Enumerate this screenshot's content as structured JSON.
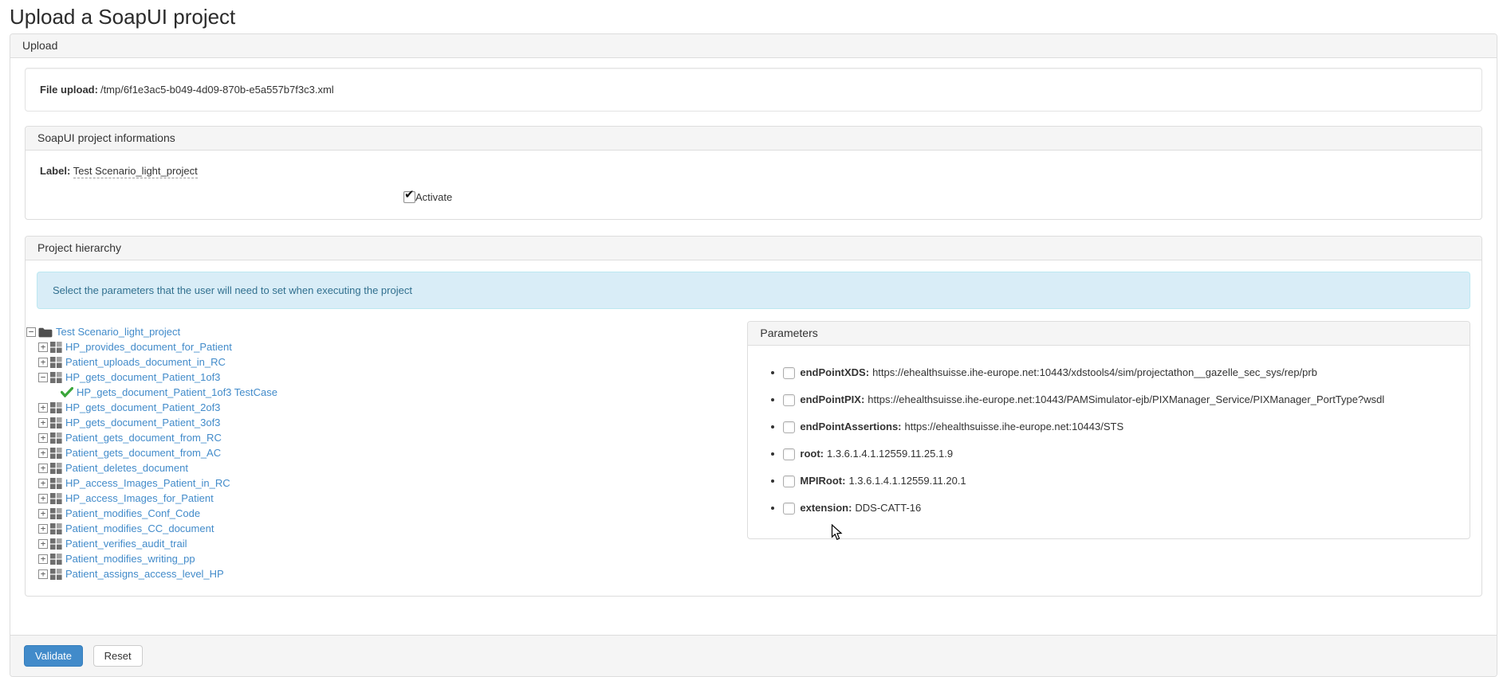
{
  "page": {
    "title": "Upload a SoapUI project"
  },
  "upload_panel": {
    "heading": "Upload",
    "file_upload_label": "File upload:",
    "file_path": "/tmp/6f1e3ac5-b049-4d09-870b-e5a557b7f3c3.xml"
  },
  "info_panel": {
    "heading": "SoapUI project informations",
    "label_key": "Label:",
    "label_value": "Test Scenario_light_project",
    "activate_label": "Activate",
    "activate_checked": true
  },
  "hierarchy_panel": {
    "heading": "Project hierarchy",
    "alert": "Select the parameters that the user will need to set when executing the project",
    "tree": [
      {
        "label": "Test Scenario_light_project",
        "level": 0,
        "toggle": "minus",
        "icon": "folder"
      },
      {
        "label": "HP_provides_document_for_Patient",
        "level": 1,
        "toggle": "plus",
        "icon": "grid"
      },
      {
        "label": "Patient_uploads_document_in_RC",
        "level": 1,
        "toggle": "plus",
        "icon": "grid"
      },
      {
        "label": "HP_gets_document_Patient_1of3",
        "level": 1,
        "toggle": "minus",
        "icon": "grid"
      },
      {
        "label": "HP_gets_document_Patient_1of3 TestCase",
        "level": 2,
        "toggle": "none",
        "icon": "check"
      },
      {
        "label": "HP_gets_document_Patient_2of3",
        "level": 1,
        "toggle": "plus",
        "icon": "grid"
      },
      {
        "label": "HP_gets_document_Patient_3of3",
        "level": 1,
        "toggle": "plus",
        "icon": "grid"
      },
      {
        "label": "Patient_gets_document_from_RC",
        "level": 1,
        "toggle": "plus",
        "icon": "grid"
      },
      {
        "label": "Patient_gets_document_from_AC",
        "level": 1,
        "toggle": "plus",
        "icon": "grid"
      },
      {
        "label": "Patient_deletes_document",
        "level": 1,
        "toggle": "plus",
        "icon": "grid"
      },
      {
        "label": "HP_access_Images_Patient_in_RC",
        "level": 1,
        "toggle": "plus",
        "icon": "grid"
      },
      {
        "label": "HP_access_Images_for_Patient",
        "level": 1,
        "toggle": "plus",
        "icon": "grid"
      },
      {
        "label": "Patient_modifies_Conf_Code",
        "level": 1,
        "toggle": "plus",
        "icon": "grid"
      },
      {
        "label": "Patient_modifies_CC_document",
        "level": 1,
        "toggle": "plus",
        "icon": "grid"
      },
      {
        "label": "Patient_verifies_audit_trail",
        "level": 1,
        "toggle": "plus",
        "icon": "grid"
      },
      {
        "label": "Patient_modifies_writing_pp",
        "level": 1,
        "toggle": "plus",
        "icon": "grid"
      },
      {
        "label": "Patient_assigns_access_level_HP",
        "level": 1,
        "toggle": "plus",
        "icon": "grid"
      }
    ]
  },
  "parameters_panel": {
    "heading": "Parameters",
    "items": [
      {
        "name": "endPointXDS:",
        "value": "https://ehealthsuisse.ihe-europe.net:10443/xdstools4/sim/projectathon__gazelle_sec_sys/rep/prb",
        "checked": false
      },
      {
        "name": "endPointPIX:",
        "value": "https://ehealthsuisse.ihe-europe.net:10443/PAMSimulator-ejb/PIXManager_Service/PIXManager_PortType?wsdl",
        "checked": false
      },
      {
        "name": "endPointAssertions:",
        "value": "https://ehealthsuisse.ihe-europe.net:10443/STS",
        "checked": false
      },
      {
        "name": "root:",
        "value": "1.3.6.1.4.1.12559.11.25.1.9",
        "checked": false
      },
      {
        "name": "MPIRoot:",
        "value": "1.3.6.1.4.1.12559.11.20.1",
        "checked": false
      },
      {
        "name": "extension:",
        "value": "DDS-CATT-16",
        "checked": false
      }
    ]
  },
  "footer": {
    "validate_label": "Validate",
    "reset_label": "Reset"
  },
  "colors": {
    "primary_button": "#428bca",
    "tree_link": "#428bca",
    "testcase_check": "#3aa63a",
    "alert_bg": "#d9edf7",
    "alert_text": "#31708f",
    "panel_heading_bg": "#f5f5f5",
    "panel_border": "#dddddd"
  }
}
